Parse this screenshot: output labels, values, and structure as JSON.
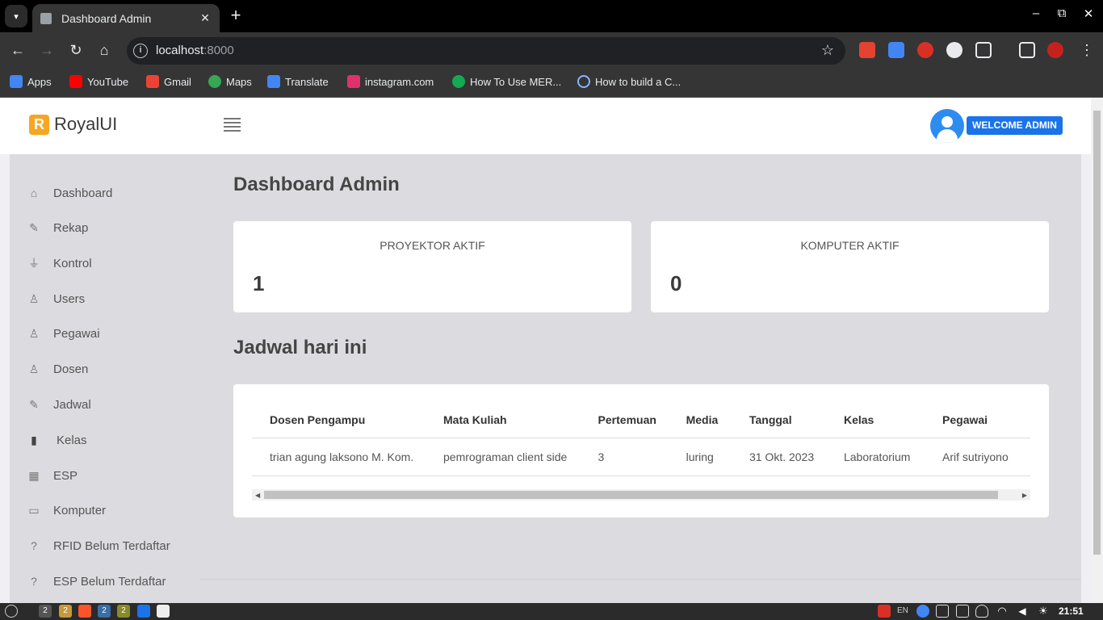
{
  "browser": {
    "tab_title": "Dashboard Admin",
    "url_host": "localhost",
    "url_port": ":8000",
    "bookmarks": [
      {
        "label": "Apps",
        "icon": "apps-grid-icon",
        "color": "#4285f4"
      },
      {
        "label": "YouTube",
        "icon": "youtube-icon",
        "color": "#ff0000"
      },
      {
        "label": "Gmail",
        "icon": "gmail-icon",
        "color": "#ea4335"
      },
      {
        "label": "Maps",
        "icon": "maps-icon",
        "color": "#34a853"
      },
      {
        "label": "Translate",
        "icon": "translate-icon",
        "color": "#4285f4"
      },
      {
        "label": "instagram.com",
        "icon": "instagram-icon",
        "color": "#e1306c"
      },
      {
        "label": "How To Use MER...",
        "icon": "mongodb-icon",
        "color": "#13aa52"
      },
      {
        "label": "How to build a C...",
        "icon": "link-icon",
        "color": "#8ab4f8"
      }
    ]
  },
  "app": {
    "brand_letter": "R",
    "brand": "RoyalUI",
    "welcome": "WELCOME ADMIN",
    "accent_color": "#1a73e8",
    "brand_color": "#f6a623"
  },
  "sidebar": {
    "items": [
      {
        "label": "Dashboard",
        "icon": "home-icon",
        "glyph": "⌂"
      },
      {
        "label": "Rekap",
        "icon": "edit-icon",
        "glyph": "✎"
      },
      {
        "label": "Kontrol",
        "icon": "plug-icon",
        "glyph": "⏚"
      },
      {
        "label": "Users",
        "icon": "user-icon",
        "glyph": "♙"
      },
      {
        "label": "Pegawai",
        "icon": "user-icon",
        "glyph": "♙"
      },
      {
        "label": "Dosen",
        "icon": "user-icon",
        "glyph": "♙"
      },
      {
        "label": "Jadwal",
        "icon": "edit-icon",
        "glyph": "✎"
      },
      {
        "label": "Kelas",
        "icon": "door-icon",
        "glyph": "▮"
      },
      {
        "label": "ESP",
        "icon": "chip-icon",
        "glyph": "▦"
      },
      {
        "label": "Komputer",
        "icon": "monitor-icon",
        "glyph": "▭"
      },
      {
        "label": "RFID Belum Terdaftar",
        "icon": "question-icon",
        "glyph": "?"
      },
      {
        "label": "ESP Belum Terdaftar",
        "icon": "question-icon",
        "glyph": "?"
      }
    ]
  },
  "main": {
    "title": "Dashboard Admin",
    "stats": [
      {
        "label": "PROYEKTOR AKTIF",
        "value": "1"
      },
      {
        "label": "KOMPUTER AKTIF",
        "value": "0"
      }
    ],
    "schedule_title": "Jadwal hari ini",
    "table": {
      "headers": [
        "Dosen Pengampu",
        "Mata Kuliah",
        "Pertemuan",
        "Media",
        "Tanggal",
        "Kelas",
        "Pegawai"
      ],
      "rows": [
        [
          "trian agung laksono M. Kom.",
          "pemrograman client side",
          "3",
          "luring",
          "31 Okt. 2023",
          "Laboratorium",
          "Arif sutriyono"
        ]
      ]
    }
  },
  "taskbar": {
    "lang": "EN",
    "clock": "21:51"
  }
}
